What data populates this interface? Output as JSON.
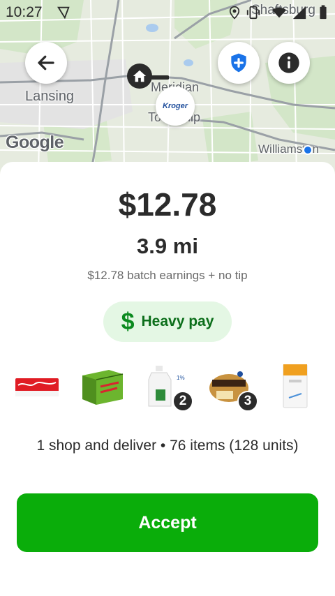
{
  "status_bar": {
    "time": "10:27",
    "icons": [
      "navigation-icon",
      "location-icon",
      "vibrate-icon",
      "wifi-icon",
      "signal-icon",
      "battery-icon"
    ]
  },
  "map": {
    "labels": {
      "lansing": "Lansing",
      "meridian": "Meridian",
      "township": "Township",
      "shaftsburg": "Shaftsburg",
      "williamston": "Williamston"
    },
    "google_logo": "Google",
    "store_pin_label": "Kroger",
    "buttons": {
      "back_icon": "arrow-left-icon",
      "safety_icon": "shield-plus-icon",
      "info_icon": "info-icon"
    },
    "colors": {
      "shield_blue": "#1a73e8",
      "location_blue": "#1a73e8"
    }
  },
  "offer": {
    "price": "$12.78",
    "distance": "3.9 mi",
    "earnings_detail": "$12.78 batch earnings + no tip",
    "badge": {
      "icon": "dollar-icon",
      "label": "Heavy pay",
      "color": "#0b8a1f",
      "background": "#e4f7e4"
    },
    "items": [
      {
        "name": "Coca-Cola 24 pack",
        "icon": "coca-cola-pack-icon",
        "quantity": ""
      },
      {
        "name": "Mountain Dew case",
        "icon": "mountain-dew-case-icon",
        "quantity": ""
      },
      {
        "name": "Milk gallon",
        "icon": "milk-jug-icon",
        "quantity": "2"
      },
      {
        "name": "Ground beef",
        "icon": "ground-beef-icon",
        "quantity": "3"
      },
      {
        "name": "Sugar",
        "icon": "sugar-bag-icon",
        "quantity": ""
      }
    ],
    "summary": "1 shop and deliver • 76 items (128 units)",
    "accept_label": "Accept",
    "accept_color": "#0aad0a"
  }
}
